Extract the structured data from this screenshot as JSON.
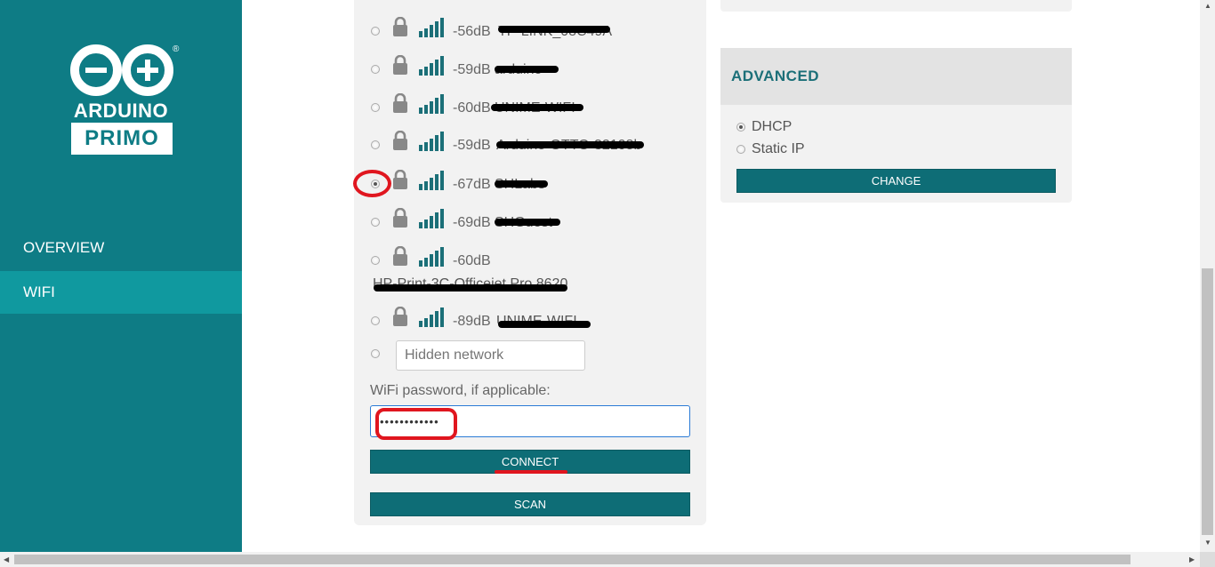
{
  "brand": {
    "name": "ARDUINO",
    "model": "PRIMO",
    "reg": "®"
  },
  "nav": {
    "overview": "OVERVIEW",
    "wifi": "WIFI"
  },
  "networks": [
    {
      "db": "-56dB",
      "ssid": "TP-LINK_08C49A",
      "selected": false
    },
    {
      "db": "-59dB",
      "ssid": "arduino",
      "selected": false
    },
    {
      "db": "-60dB",
      "ssid": "UNIME-WIFI",
      "selected": false
    },
    {
      "db": "-59dB",
      "ssid": "Arduino-OTTO-32108b",
      "selected": false
    },
    {
      "db": "-67dB",
      "ssid": "SHLabs",
      "selected": true
    },
    {
      "db": "-69dB",
      "ssid": "SHGuest",
      "selected": false
    },
    {
      "db": "-60dB",
      "ssid": "HP-Print-3C-Officejet Pro 8620",
      "selected": false
    },
    {
      "db": "-89dB",
      "ssid": "UNIME-WIFI",
      "selected": false
    }
  ],
  "hidden_network": {
    "placeholder": "Hidden network"
  },
  "password": {
    "label": "WiFi password, if applicable:",
    "value": "••••••••••••"
  },
  "buttons": {
    "connect": "CONNECT",
    "scan": "SCAN",
    "change": "CHANGE"
  },
  "advanced": {
    "title": "ADVANCED",
    "options": [
      {
        "label": "DHCP",
        "selected": true
      },
      {
        "label": "Static IP",
        "selected": false
      }
    ]
  },
  "colors": {
    "primary": "#0e7c85",
    "active_nav": "#10999f",
    "button": "#0e6d76",
    "highlight": "#e0161f"
  }
}
